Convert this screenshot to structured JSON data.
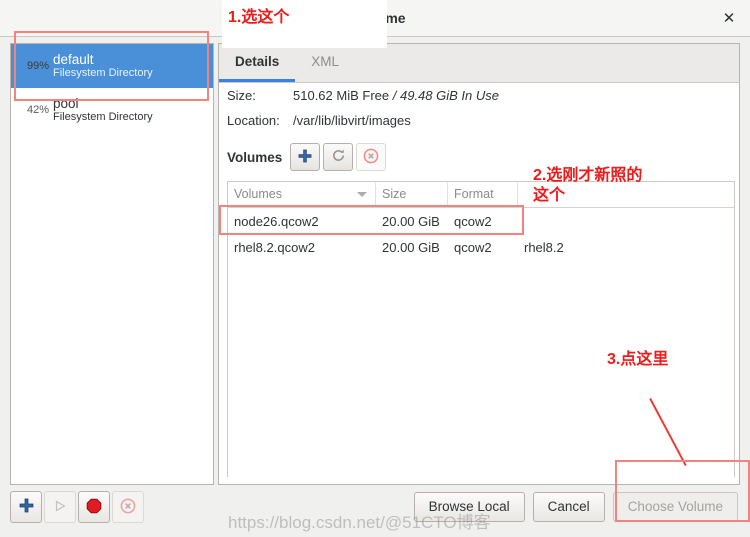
{
  "window": {
    "title_visible_fragment": "e Volume",
    "close_label": "✕"
  },
  "tabs": [
    {
      "label": "Details",
      "active": true
    },
    {
      "label": "XML",
      "active": false
    }
  ],
  "pools": [
    {
      "percent": "99%",
      "name": "default",
      "type": "Filesystem Directory",
      "selected": true
    },
    {
      "percent": "42%",
      "name": "pool",
      "type": "Filesystem Directory",
      "selected": false
    }
  ],
  "pool_toolbar": [
    {
      "icon": "add-icon",
      "enabled": true
    },
    {
      "icon": "play-icon",
      "enabled": false
    },
    {
      "icon": "stop-icon",
      "enabled": true
    },
    {
      "icon": "delete-icon",
      "enabled": true
    }
  ],
  "details": {
    "size_label": "Size:",
    "size_free": "510.62 MiB Free",
    "size_sep": "/",
    "size_used": "49.48 GiB In Use",
    "location_label": "Location:",
    "location_value": "/var/lib/libvirt/images"
  },
  "volumes": {
    "section_label": "Volumes",
    "toolbar": [
      {
        "icon": "add-volume-icon",
        "enabled": true
      },
      {
        "icon": "refresh-icon",
        "enabled": true
      },
      {
        "icon": "delete-volume-icon",
        "enabled": true
      }
    ],
    "columns": [
      "Volumes",
      "Size",
      "Format",
      ""
    ],
    "sorted_column": 0,
    "rows": [
      {
        "cells": [
          "node26.qcow2",
          "20.00 GiB",
          "qcow2",
          ""
        ],
        "highlighted": true
      },
      {
        "cells": [
          "rhel8.2.qcow2",
          "20.00 GiB",
          "qcow2",
          "rhel8.2"
        ],
        "highlighted": false
      }
    ]
  },
  "actions": [
    {
      "label": "Browse Local",
      "enabled": true
    },
    {
      "label": "Cancel",
      "enabled": true
    },
    {
      "label": "Choose Volume",
      "enabled": false
    }
  ],
  "annotations": [
    {
      "id": "step1",
      "text": "1.选这个"
    },
    {
      "id": "step2",
      "text": "2.选刚才新照的\n这个"
    },
    {
      "id": "step3",
      "text": "3.点这里"
    }
  ],
  "watermark": {
    "text": "https://blog.csdn.net/@51CTO博客"
  },
  "colors": {
    "selection_blue": "#4a90d9",
    "tab_accent": "#3584e4",
    "annotation_red": "#ee1b1b",
    "annotation_rect": "#f2837f"
  }
}
